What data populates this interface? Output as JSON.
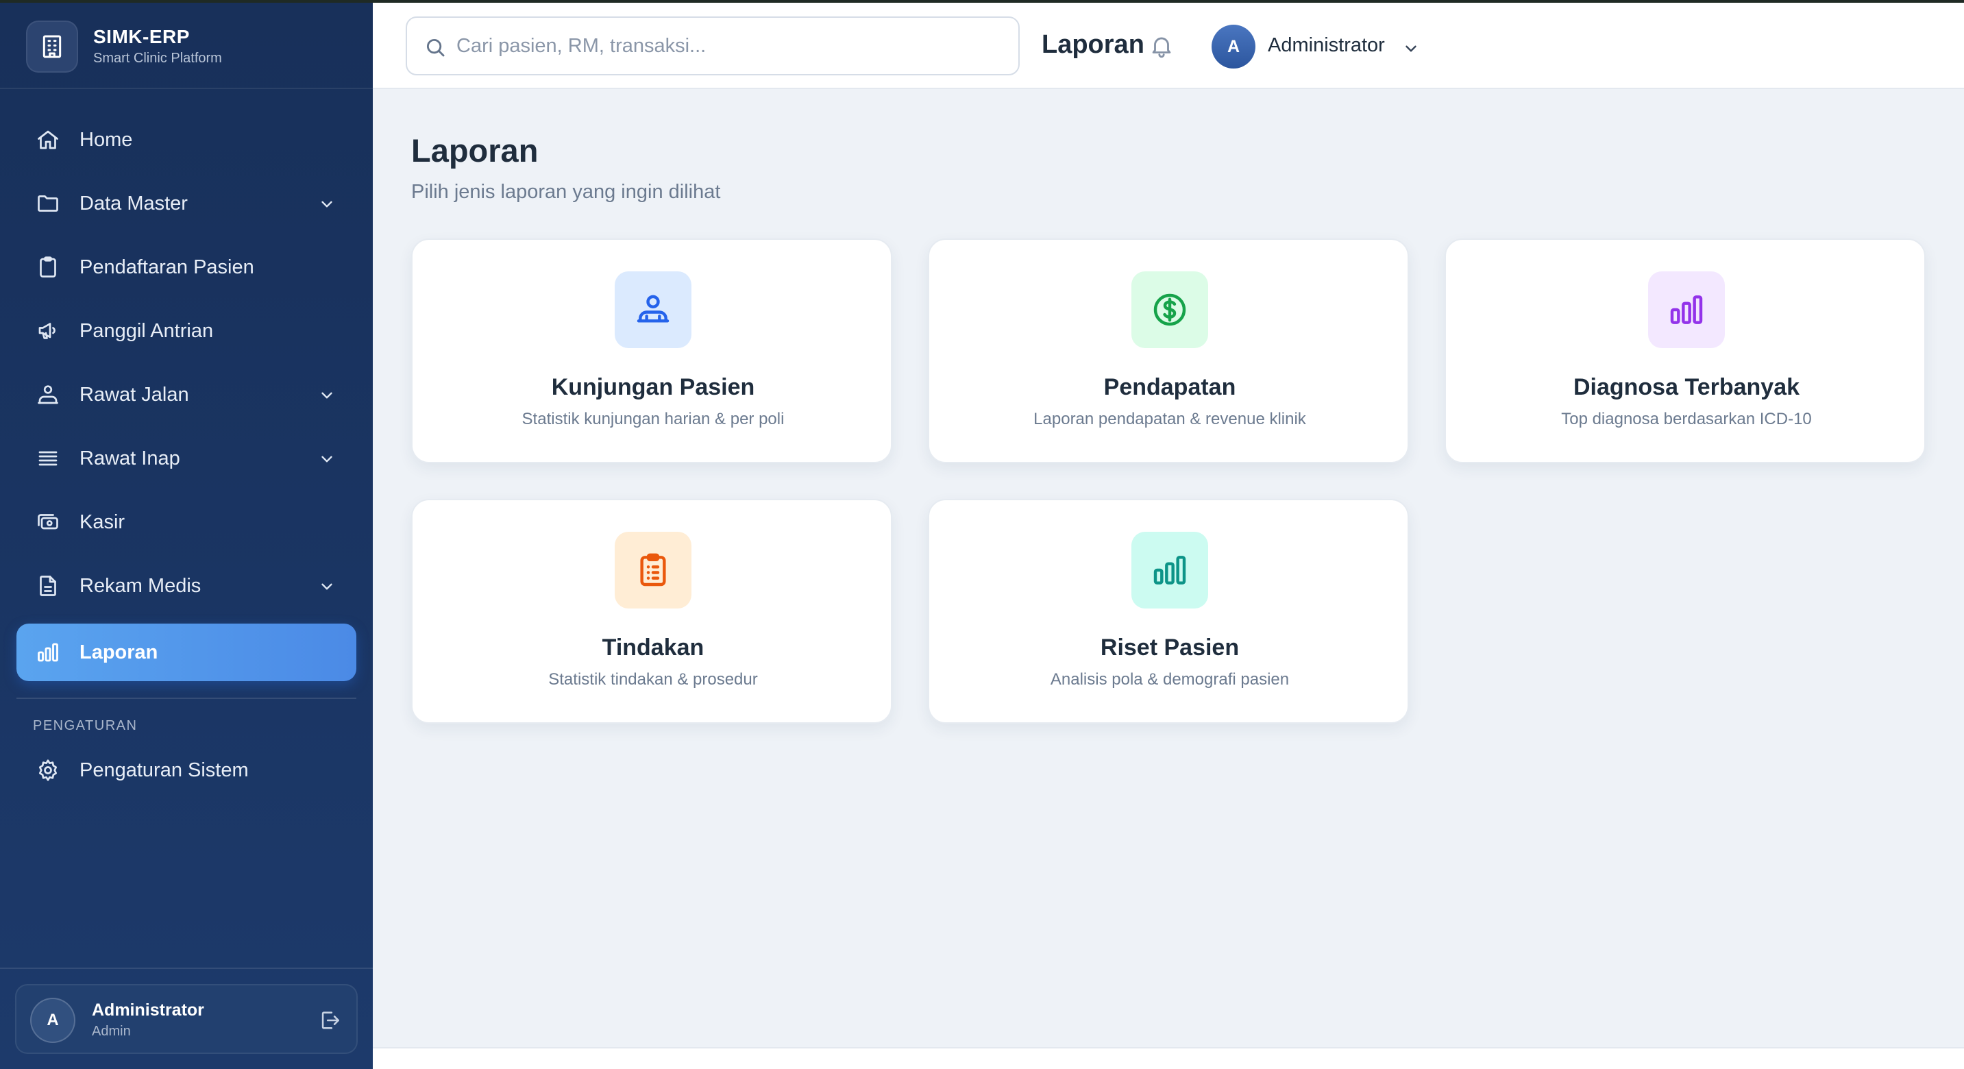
{
  "brand": {
    "title": "SIMK-ERP",
    "subtitle": "Smart Clinic Platform"
  },
  "sidebar": {
    "items": [
      {
        "label": "Home",
        "icon": "home-icon",
        "has_submenu": false,
        "active": false
      },
      {
        "label": "Data Master",
        "icon": "folder-icon",
        "has_submenu": true,
        "active": false
      },
      {
        "label": "Pendaftaran Pasien",
        "icon": "clipboard-icon",
        "has_submenu": false,
        "active": false
      },
      {
        "label": "Panggil Antrian",
        "icon": "megaphone-icon",
        "has_submenu": false,
        "active": false
      },
      {
        "label": "Rawat Jalan",
        "icon": "user-icon",
        "has_submenu": true,
        "active": false
      },
      {
        "label": "Rawat Inap",
        "icon": "list-icon",
        "has_submenu": true,
        "active": false
      },
      {
        "label": "Kasir",
        "icon": "cash-icon",
        "has_submenu": false,
        "active": false
      },
      {
        "label": "Rekam Medis",
        "icon": "document-icon",
        "has_submenu": true,
        "active": false
      },
      {
        "label": "Laporan",
        "icon": "bar-chart-icon",
        "has_submenu": false,
        "active": true
      }
    ],
    "section_label": "PENGATURAN",
    "settings_item": {
      "label": "Pengaturan Sistem",
      "icon": "gear-icon"
    },
    "user": {
      "initial": "A",
      "name": "Administrator",
      "role": "Admin"
    }
  },
  "header": {
    "search_placeholder": "Cari pasien, RM, transaksi...",
    "title": "Laporan",
    "user_initial": "A",
    "user_name": "Administrator"
  },
  "main": {
    "title": "Laporan",
    "subtitle": "Pilih jenis laporan yang ingin dilihat",
    "cards": [
      {
        "title": "Kunjungan Pasien",
        "desc": "Statistik kunjungan harian & per poli",
        "icon": "patient-icon",
        "tile_color": "#dbeafe",
        "icon_color": "#2563eb"
      },
      {
        "title": "Pendapatan",
        "desc": "Laporan pendapatan & revenue klinik",
        "icon": "dollar-icon",
        "tile_color": "#dcfce7",
        "icon_color": "#16a34a"
      },
      {
        "title": "Diagnosa Terbanyak",
        "desc": "Top diagnosa berdasarkan ICD-10",
        "icon": "bar-chart-icon",
        "tile_color": "#f3e8ff",
        "icon_color": "#9333ea"
      },
      {
        "title": "Tindakan",
        "desc": "Statistik tindakan & prosedur",
        "icon": "clipboard-list-icon",
        "tile_color": "#ffedd5",
        "icon_color": "#ea580c"
      },
      {
        "title": "Riset Pasien",
        "desc": "Analisis pola & demografi pasien",
        "icon": "bar-chart-icon",
        "tile_color": "#ccfbf1",
        "icon_color": "#0d9488"
      }
    ]
  },
  "colors": {
    "sidebar_bg": "#1a3563",
    "active_accent": "#4b8ae6",
    "page_bg": "#eef2f7"
  }
}
